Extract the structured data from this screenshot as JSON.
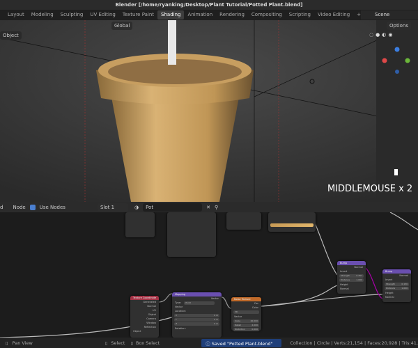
{
  "title": "Blender [/home/ryanking/Desktop/Plant Tutorial/Potted Plant.blend]",
  "tabs": [
    "Layout",
    "Modeling",
    "Sculpting",
    "UV Editing",
    "Texture Paint",
    "Shading",
    "Animation",
    "Rendering",
    "Compositing",
    "Scripting",
    "Video Editing",
    "+"
  ],
  "active_tab": "Shading",
  "scene": "Scene",
  "viewport": {
    "transform": "Global",
    "options": "Options",
    "mode": "Object",
    "overlay_text": "MIDDLEMOUSE x 2"
  },
  "node_header": {
    "view": "d",
    "node": "Node",
    "use_nodes": "Use Nodes",
    "slot": "Slot 1",
    "material": "Pot"
  },
  "nodes": {
    "texcoord": {
      "title": "Texture Coordinate",
      "outputs": [
        "Generated",
        "Normal",
        "UV",
        "Object",
        "Camera",
        "Window",
        "Reflection"
      ],
      "object_label": "Object"
    },
    "mapping": {
      "title": "Mapping",
      "out": "Vector",
      "type_label": "Type:",
      "type": "Point",
      "vector": "Vector",
      "location": "Location:",
      "loc": [
        "X",
        "Y",
        "Z"
      ],
      "loc_val": "0 m",
      "rotation": "Rotation:"
    },
    "noise": {
      "title": "Noise Texture",
      "outs": [
        "Fac",
        "Color"
      ],
      "dim": "3D",
      "vector": "Vector",
      "scale": "Scale",
      "scale_val": "20.000",
      "detail": "Detail",
      "detail_val": "2.000",
      "distortion": "Distortion",
      "distortion_val": "0.000"
    },
    "bump1": {
      "title": "Bump",
      "normal": "Normal",
      "invert": "Invert",
      "strength": "Strength",
      "strength_val": "0.257",
      "distance": "Distance",
      "distance_val": "1.000",
      "height": "Height",
      "normal_in": "Normal"
    },
    "bump2": {
      "title": "Bump",
      "normal": "Normal",
      "invert": "Invert",
      "strength": "Strength",
      "strength_val": "0.150",
      "distance": "Distance",
      "distance_val": "1.000",
      "height": "Height",
      "normal_in": "Normal"
    }
  },
  "status": {
    "pan": "Pan View",
    "select": "Select",
    "box_select": "Box Select",
    "saved": "Saved \"Potted Plant.blend\"",
    "stats": "Collection | Circle | Verts:21,154 | Faces:20,928 | Tris:41,"
  }
}
